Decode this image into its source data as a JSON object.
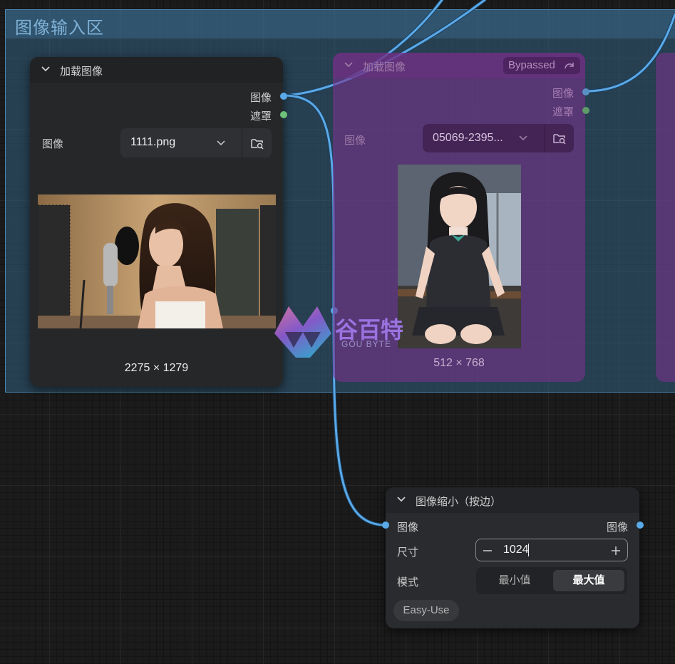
{
  "group": {
    "title": "图像输入区"
  },
  "node_load1": {
    "title": "加载图像",
    "outputs": [
      "图像",
      "遮罩"
    ],
    "image_widget": {
      "label": "图像",
      "value": "1111.png"
    },
    "preview_size": "2275 × 1279"
  },
  "node_load2": {
    "title": "加载图像",
    "badge": "Bypassed",
    "outputs": [
      "图像",
      "遮罩"
    ],
    "image_widget": {
      "label": "图像",
      "value": "05069-2395..."
    },
    "preview_size": "512 × 768"
  },
  "node_resize": {
    "title": "图像缩小（按边）",
    "input": "图像",
    "output": "图像",
    "size": {
      "label": "尺寸",
      "value": "1024"
    },
    "mode": {
      "label": "模式",
      "options": [
        "最小值",
        "最大值"
      ],
      "selected": "最大值"
    },
    "tag": "Easy-Use"
  },
  "watermark": {
    "cn": "谷百特",
    "en": "GOU BYTE"
  },
  "colors": {
    "image_link": "#5aa9e8",
    "mask_dot": "#6dc27a",
    "bypass": "#7a3590",
    "group": "#386e96"
  }
}
